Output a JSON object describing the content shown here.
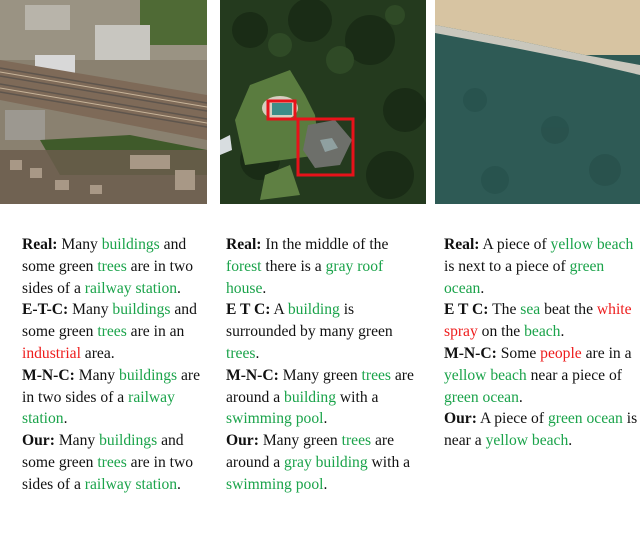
{
  "colors": {
    "correct": "#1aa34a",
    "wrong": "#ee1c1c",
    "box": "#e8121a"
  },
  "images": [
    {
      "subject": "railway-station-aerial"
    },
    {
      "subject": "forest-house-aerial",
      "annotations": [
        "swimming-pool-box",
        "building-box"
      ]
    },
    {
      "subject": "beach-ocean-aerial"
    }
  ],
  "columns": [
    {
      "entries": [
        {
          "label": "Real:",
          "segments": [
            {
              "t": " Many ",
              "c": ""
            },
            {
              "t": "buildings",
              "c": "g"
            },
            {
              "t": " and some green ",
              "c": ""
            },
            {
              "t": "trees",
              "c": "g"
            },
            {
              "t": " are in two sides of a ",
              "c": ""
            },
            {
              "t": "railway station",
              "c": "g"
            },
            {
              "t": ".",
              "c": ""
            }
          ]
        },
        {
          "label": "E-T-C:",
          "segments": [
            {
              "t": " Many ",
              "c": ""
            },
            {
              "t": "buildings",
              "c": "g"
            },
            {
              "t": " and some green ",
              "c": ""
            },
            {
              "t": "trees",
              "c": "g"
            },
            {
              "t": " are in an ",
              "c": ""
            },
            {
              "t": "industrial",
              "c": "r"
            },
            {
              "t": " area.",
              "c": ""
            }
          ]
        },
        {
          "label": "M-N-C:",
          "segments": [
            {
              "t": " Many ",
              "c": ""
            },
            {
              "t": "buildings",
              "c": "g"
            },
            {
              "t": " are in two sides of a ",
              "c": ""
            },
            {
              "t": "railway station",
              "c": "g"
            },
            {
              "t": ".",
              "c": ""
            }
          ]
        },
        {
          "label": "Our:",
          "segments": [
            {
              "t": " Many ",
              "c": ""
            },
            {
              "t": "buildings",
              "c": "g"
            },
            {
              "t": " and some green ",
              "c": ""
            },
            {
              "t": "trees",
              "c": "g"
            },
            {
              "t": " are in two sides of a ",
              "c": ""
            },
            {
              "t": "railway station",
              "c": "g"
            },
            {
              "t": ".",
              "c": ""
            }
          ]
        }
      ]
    },
    {
      "entries": [
        {
          "label": "Real:",
          "segments": [
            {
              "t": " In the middle of the ",
              "c": ""
            },
            {
              "t": "forest",
              "c": "g"
            },
            {
              "t": " there is a ",
              "c": ""
            },
            {
              "t": "gray roof house",
              "c": "g"
            },
            {
              "t": ".",
              "c": ""
            }
          ]
        },
        {
          "label": "E T C:",
          "segments": [
            {
              "t": " A ",
              "c": ""
            },
            {
              "t": "building",
              "c": "g"
            },
            {
              "t": " is surrounded by many green ",
              "c": ""
            },
            {
              "t": "trees",
              "c": "g"
            },
            {
              "t": ".",
              "c": ""
            }
          ]
        },
        {
          "label": "M-N-C:",
          "segments": [
            {
              "t": " Many green ",
              "c": ""
            },
            {
              "t": "trees",
              "c": "g"
            },
            {
              "t": " are around a ",
              "c": ""
            },
            {
              "t": "building",
              "c": "g"
            },
            {
              "t": " with a ",
              "c": ""
            },
            {
              "t": "swimming pool",
              "c": "g"
            },
            {
              "t": ".",
              "c": ""
            }
          ]
        },
        {
          "label": "Our:",
          "segments": [
            {
              "t": " Many green ",
              "c": ""
            },
            {
              "t": "trees",
              "c": "g"
            },
            {
              "t": " are around a ",
              "c": ""
            },
            {
              "t": "gray building",
              "c": "g"
            },
            {
              "t": " with a ",
              "c": ""
            },
            {
              "t": "swimming pool",
              "c": "g"
            },
            {
              "t": ".",
              "c": ""
            }
          ]
        }
      ]
    },
    {
      "entries": [
        {
          "label": "Real:",
          "segments": [
            {
              "t": " A piece of ",
              "c": ""
            },
            {
              "t": "yellow beach",
              "c": "g"
            },
            {
              "t": " is next to a piece of ",
              "c": ""
            },
            {
              "t": "green ocean",
              "c": "g"
            },
            {
              "t": ".",
              "c": ""
            }
          ]
        },
        {
          "label": "E T C:",
          "segments": [
            {
              "t": " The ",
              "c": ""
            },
            {
              "t": "sea",
              "c": "g"
            },
            {
              "t": " beat the ",
              "c": ""
            },
            {
              "t": "white spray",
              "c": "r"
            },
            {
              "t": " on the ",
              "c": ""
            },
            {
              "t": "beach",
              "c": "g"
            },
            {
              "t": ".",
              "c": ""
            }
          ]
        },
        {
          "label": "M-N-C:",
          "segments": [
            {
              "t": " Some ",
              "c": ""
            },
            {
              "t": "people",
              "c": "r"
            },
            {
              "t": " are in a ",
              "c": ""
            },
            {
              "t": "yellow beach",
              "c": "g"
            },
            {
              "t": " near a piece of ",
              "c": ""
            },
            {
              "t": "green ocean",
              "c": "g"
            },
            {
              "t": ".",
              "c": ""
            }
          ]
        },
        {
          "label": "Our:",
          "segments": [
            {
              "t": " A piece of ",
              "c": ""
            },
            {
              "t": "green ocean",
              "c": "g"
            },
            {
              "t": " is near a ",
              "c": ""
            },
            {
              "t": "yellow beach",
              "c": "g"
            },
            {
              "t": ".",
              "c": ""
            }
          ]
        }
      ]
    }
  ]
}
